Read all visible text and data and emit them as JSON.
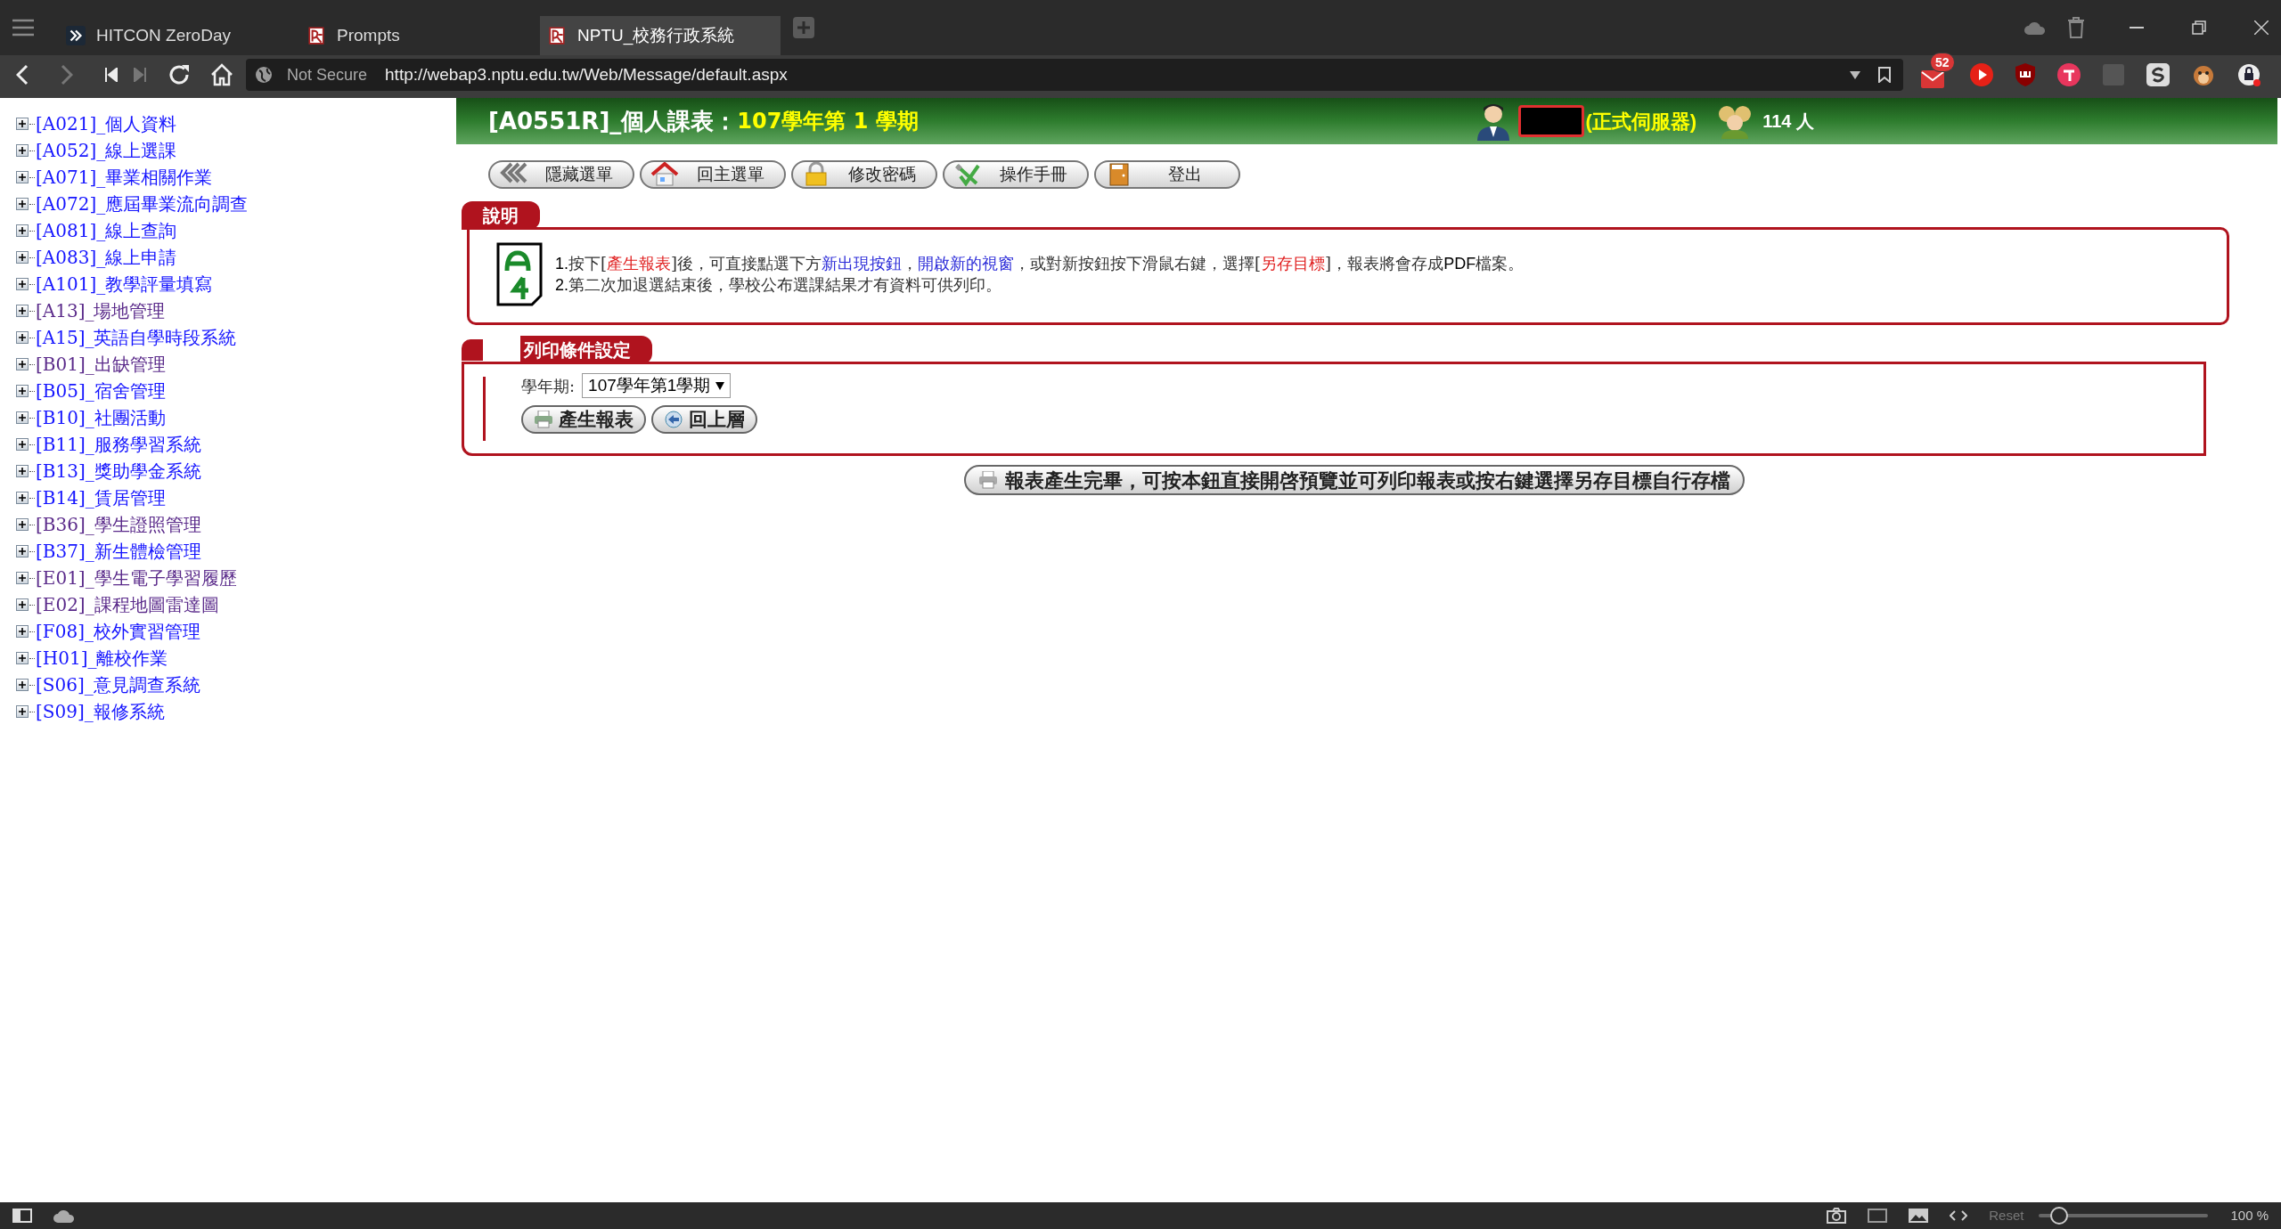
{
  "browser": {
    "tabs": [
      {
        "title": "HITCON ZeroDay",
        "kind": "chevron",
        "selected": false
      },
      {
        "title": "Prompts",
        "kind": "logo",
        "selected": false
      },
      {
        "title": "NPTU_校務行政系統",
        "kind": "logo",
        "selected": true
      }
    ],
    "address": {
      "security_label": "Not Secure",
      "url": "http://webap3.nptu.edu.tw/Web/Message/default.aspx"
    },
    "mail_badge": "52"
  },
  "sidebar": {
    "items": [
      {
        "label": "[A021]_個人資料",
        "visited": false
      },
      {
        "label": "[A052]_線上選課",
        "visited": false
      },
      {
        "label": "[A071]_畢業相關作業",
        "visited": false
      },
      {
        "label": "[A072]_應屆畢業流向調查",
        "visited": false
      },
      {
        "label": "[A081]_線上查詢",
        "visited": false
      },
      {
        "label": "[A083]_線上申請",
        "visited": false
      },
      {
        "label": "[A101]_教學評量填寫",
        "visited": false
      },
      {
        "label": "[A13]_場地管理",
        "visited": true
      },
      {
        "label": "[A15]_英語自學時段系統",
        "visited": false
      },
      {
        "label": "[B01]_出缺管理",
        "visited": true
      },
      {
        "label": "[B05]_宿舍管理",
        "visited": false
      },
      {
        "label": "[B10]_社團活動",
        "visited": false
      },
      {
        "label": "[B11]_服務學習系統",
        "visited": false
      },
      {
        "label": "[B13]_獎助學金系統",
        "visited": false
      },
      {
        "label": "[B14]_賃居管理",
        "visited": false
      },
      {
        "label": "[B36]_學生證照管理",
        "visited": true
      },
      {
        "label": "[B37]_新生體檢管理",
        "visited": false
      },
      {
        "label": "[E01]_學生電子學習履歷",
        "visited": true
      },
      {
        "label": "[E02]_課程地圖雷達圖",
        "visited": true
      },
      {
        "label": "[F08]_校外實習管理",
        "visited": false
      },
      {
        "label": "[H01]_離校作業",
        "visited": false
      },
      {
        "label": "[S06]_意見調查系統",
        "visited": false
      },
      {
        "label": "[S09]_報修系統",
        "visited": false
      }
    ]
  },
  "header": {
    "title": "[A0551R]_個人課表：",
    "term": "107學年第 1 學期",
    "server": "(正式伺服器)",
    "online_count": "114 人"
  },
  "toolbar": [
    {
      "label": "隱藏選單",
      "kind": "back"
    },
    {
      "label": "回主選單",
      "kind": "home"
    },
    {
      "label": "修改密碼",
      "kind": "lock"
    },
    {
      "label": "操作手冊",
      "kind": "tools"
    },
    {
      "label": "登出",
      "kind": "exit"
    }
  ],
  "notice": {
    "heading": "說明",
    "lines": [
      [
        {
          "text": "1.",
          "kind": "number"
        },
        {
          "text": "按下[",
          "kind": "text"
        },
        {
          "text": "產生報表",
          "kind": "red"
        },
        {
          "text": "]後，可直接點選下方",
          "kind": "text"
        },
        {
          "text": "新出現按鈕",
          "kind": "blue"
        },
        {
          "text": "，",
          "kind": "text"
        },
        {
          "text": "開啟新的視窗",
          "kind": "blue"
        },
        {
          "text": "，或對新按鈕按下滑鼠右鍵，選擇[",
          "kind": "text"
        },
        {
          "text": "另存目標",
          "kind": "red"
        },
        {
          "text": "]，報表將會存成",
          "kind": "text"
        },
        {
          "text": "PDF",
          "kind": "number"
        },
        {
          "text": "檔案。",
          "kind": "text"
        }
      ],
      [
        {
          "text": "2.",
          "kind": "number"
        },
        {
          "text": "第二次加退選結束後，學校公布選課結果才有資料可供列印。",
          "kind": "text"
        }
      ]
    ]
  },
  "print_settings": {
    "heading": "列印條件設定",
    "term_label": "學年期:",
    "term_value": "107學年第1學期",
    "buttons": [
      {
        "label": "產生報表",
        "kind": "printer"
      },
      {
        "label": "回上層",
        "kind": "back"
      }
    ]
  },
  "download_button": "報表產生完畢，可按本鈕直接開啓預覽並可列印報表或按右鍵選擇另存目標自行存檔",
  "status_bar": {
    "reset_label": "Reset",
    "zoom_slider": {
      "level": 0.1
    },
    "zoom": "100 %"
  }
}
